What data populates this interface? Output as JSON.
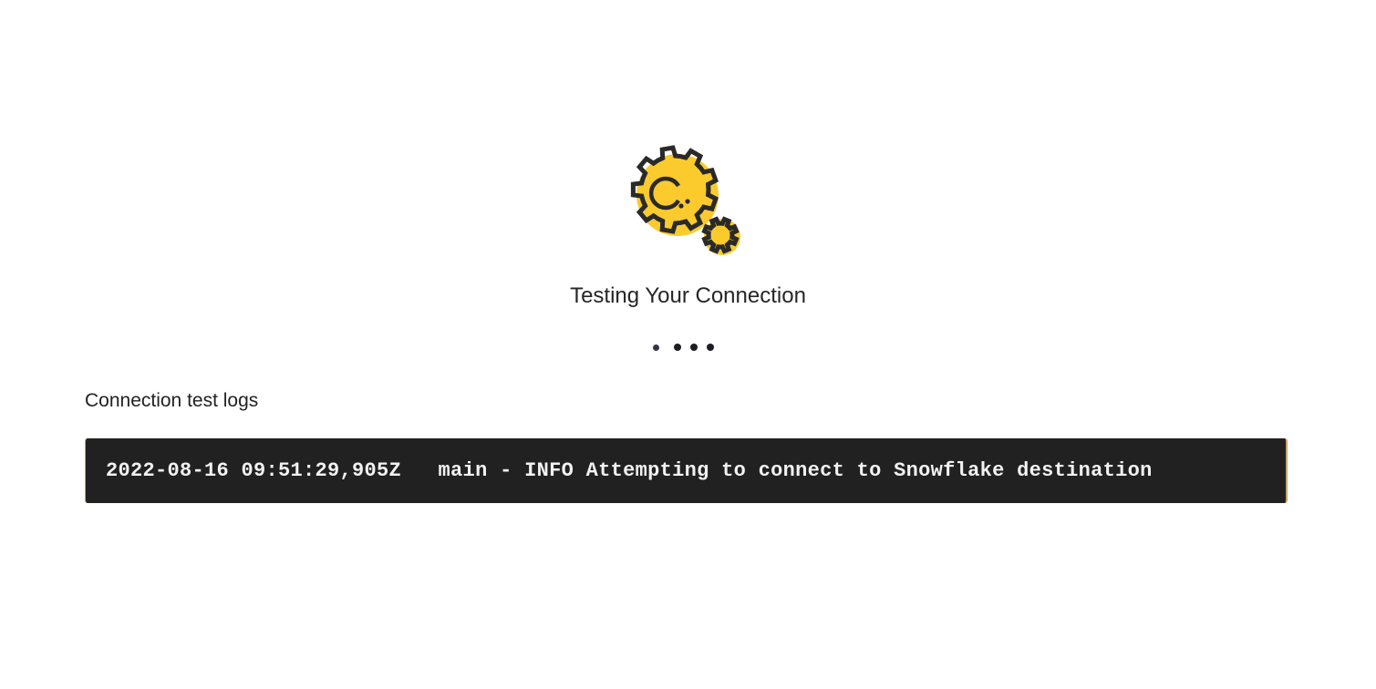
{
  "status": {
    "icon": "gears-icon",
    "title": "Testing Your Connection",
    "loading_indicator": "loading-dots"
  },
  "logs": {
    "label": "Connection test logs",
    "lines": [
      "2022-08-16 09:51:29,905Z   main - INFO Attempting to connect to Snowflake destination"
    ]
  },
  "colors": {
    "accent": "#fbcb2e",
    "icon_stroke": "#2a2a2a",
    "log_background": "#212121",
    "log_text": "#f2f2f2"
  }
}
